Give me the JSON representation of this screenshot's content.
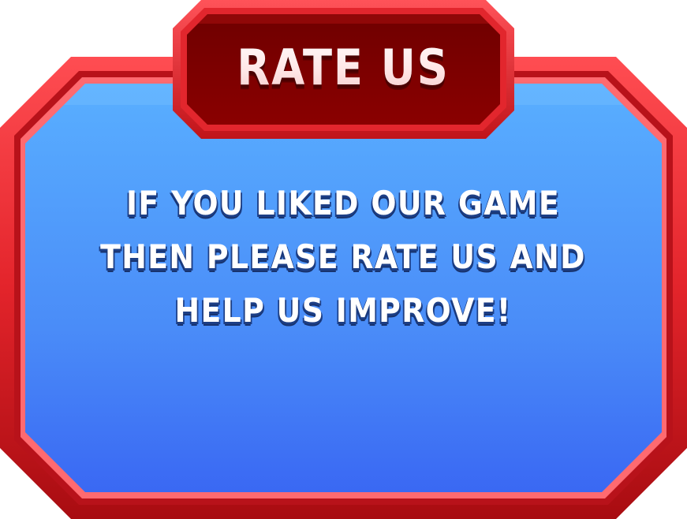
{
  "popup": {
    "title": "RATE US",
    "message_lines": [
      "IF YOU LIKED OUR GAME",
      "THEN PLEASE RATE US AND",
      "HELP US IMPROVE!"
    ]
  },
  "colors": {
    "frame_red": "#e3242b",
    "frame_dark_red": "#b30f14",
    "title_plate": "#7d0000",
    "panel_blue_top": "#58abff",
    "panel_blue_bottom": "#3d6ff5",
    "text_shadow_blue": "#1d3f86"
  }
}
